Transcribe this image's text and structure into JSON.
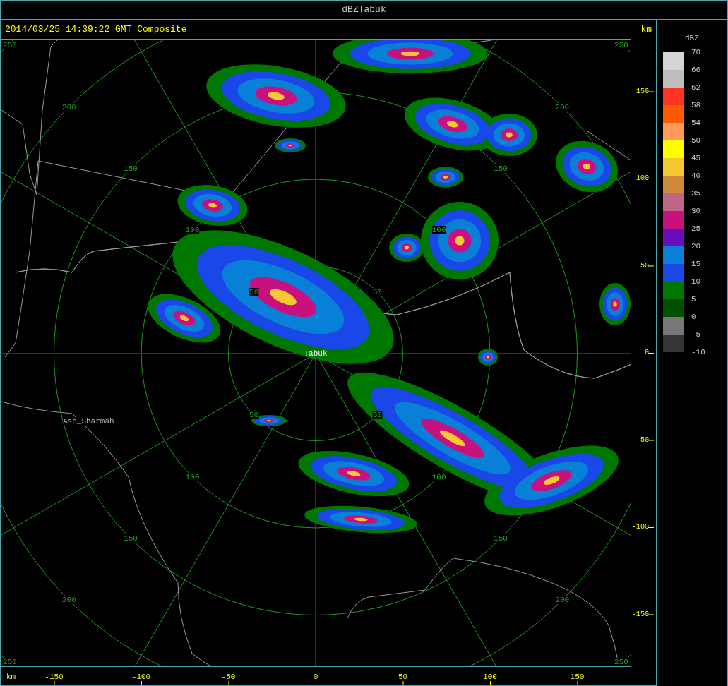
{
  "window": {
    "title": "dBZTabuk"
  },
  "header": {
    "timestamp": "2014/03/25 14:39:22 GMT Composite",
    "unit": "km"
  },
  "map": {
    "places": [
      {
        "kind": "radar",
        "label": "Tabuk"
      },
      {
        "kind": "town",
        "label": "Ash_Sharmah"
      }
    ],
    "ring_labels": [
      "50",
      "50",
      "50",
      "50",
      "100",
      "100",
      "100",
      "100",
      "150",
      "150",
      "150",
      "150",
      "200",
      "200",
      "200",
      "200",
      "250",
      "250",
      "250",
      "250"
    ]
  },
  "y_axis": {
    "ticks": [
      "150",
      "100",
      "50",
      "0",
      "-50",
      "-100",
      "-150"
    ]
  },
  "x_axis": {
    "unit": "km",
    "ticks": [
      "-150",
      "-100",
      "-50",
      "0",
      "50",
      "100",
      "150"
    ]
  },
  "legend": {
    "title": "dBZ",
    "bins": [
      {
        "color": "#d4d4d4"
      },
      {
        "color": "#bdbdbd"
      },
      {
        "color": "#ff3322"
      },
      {
        "color": "#ff5a00"
      },
      {
        "color": "#ff9a5a"
      },
      {
        "color": "#ffff00"
      },
      {
        "color": "#f8c832"
      },
      {
        "color": "#d08a3e"
      },
      {
        "color": "#bd6686"
      },
      {
        "color": "#c8107e"
      },
      {
        "color": "#680ec0"
      },
      {
        "color": "#0880d8"
      },
      {
        "color": "#1a48e8"
      },
      {
        "color": "#007800"
      },
      {
        "color": "#005200"
      },
      {
        "color": "#777777"
      },
      {
        "color": "#353535"
      }
    ],
    "labels": [
      "70",
      "66",
      "62",
      "58",
      "54",
      "50",
      "45",
      "40",
      "35",
      "30",
      "25",
      "20",
      "15",
      "10",
      "5",
      "0",
      "-5",
      "-10"
    ]
  }
}
